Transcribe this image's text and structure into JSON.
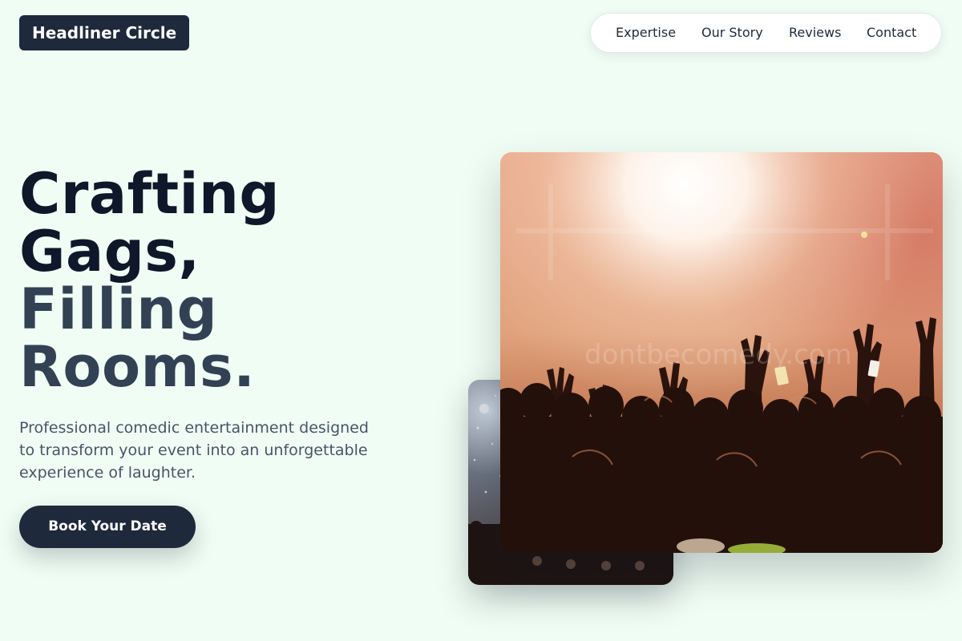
{
  "brand": {
    "logo_text": "Headliner Circle"
  },
  "nav": {
    "items": [
      {
        "label": "Expertise"
      },
      {
        "label": "Our Story"
      },
      {
        "label": "Reviews"
      },
      {
        "label": "Contact"
      }
    ]
  },
  "hero": {
    "title_lines": [
      "Crafting",
      "Gags,",
      "Filling",
      "Rooms."
    ],
    "subtitle": "Professional comedic entertainment designed to transform your event into an unforgettable experience of laughter.",
    "cta_label": "Book Your Date"
  },
  "images": {
    "main_photo": "concert-crowd-stage-lights-photo",
    "small_photo": "concert-crowd-confetti-photo",
    "watermark": "dontbecomedy.com"
  },
  "colors": {
    "background": "#f0fdf4",
    "primary_dark": "#1e293b",
    "heading_dark": "#0f172a",
    "heading_mid": "#334155",
    "body_text": "#475569",
    "white": "#ffffff"
  }
}
